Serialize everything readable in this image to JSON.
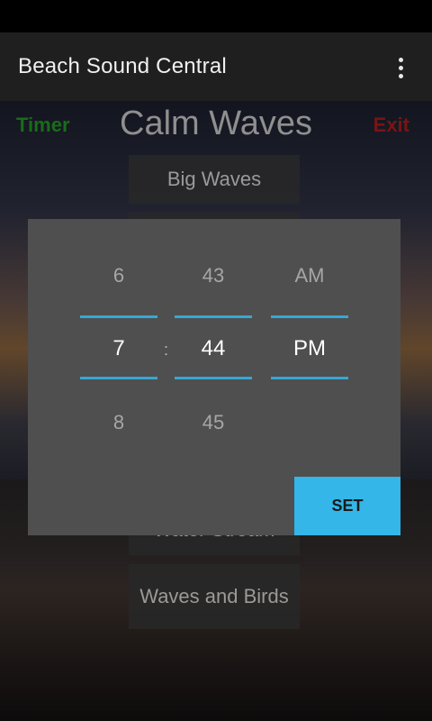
{
  "app_bar": {
    "title": "Beach Sound Central",
    "menu_icon": "more-vert-icon"
  },
  "screen": {
    "timer_label": "Timer",
    "exit_label": "Exit",
    "current_sound": "Calm Waves",
    "sounds": [
      "Big Waves",
      "",
      "Water Stream",
      "Waves and Birds"
    ]
  },
  "time_picker": {
    "hour": {
      "prev": "6",
      "selected": "7",
      "next": "8"
    },
    "separator": ":",
    "minute": {
      "prev": "43",
      "selected": "44",
      "next": "45"
    },
    "period": {
      "prev": "AM",
      "selected": "PM"
    },
    "set_label": "SET",
    "accent_color": "#35a8d6",
    "button_color": "#34b6e8"
  }
}
